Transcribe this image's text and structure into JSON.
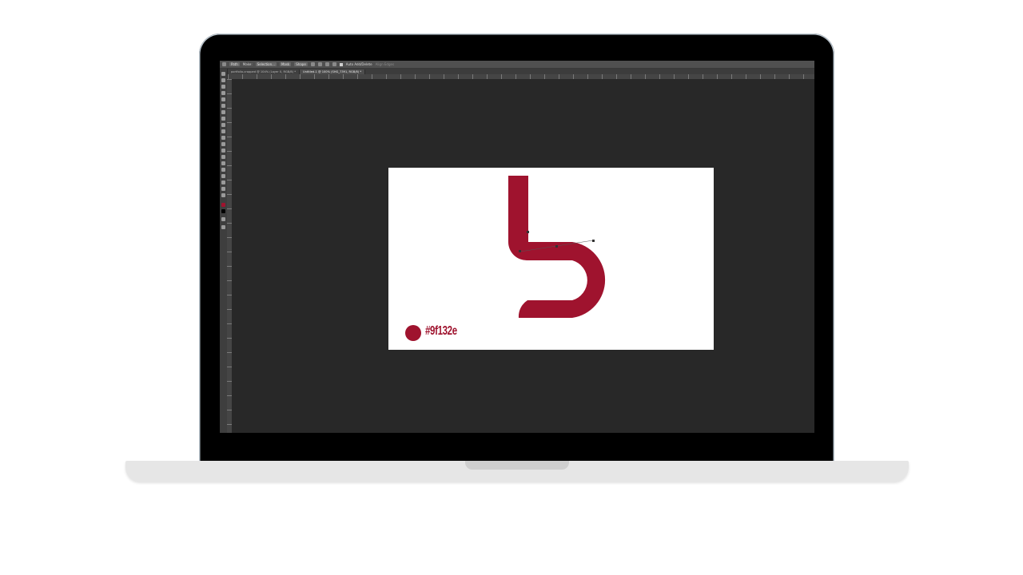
{
  "options_bar": {
    "tool_mode": "Path",
    "make_label": "Make:",
    "selection_button": "Selection...",
    "mask_button": "Mask",
    "shape_button": "Shape",
    "auto_add_delete": "Auto Add/Delete",
    "align_edges": "Align Edges"
  },
  "tabs": [
    {
      "label": "portfolio-cropped @ 104% (Layer 0, RGB/8) *"
    },
    {
      "label": "Untitled-1 @ 100% (SHG_7391, RGB/8) *"
    }
  ],
  "canvas": {
    "hex_label": "#9f132e",
    "accent_color": "#9f132e"
  }
}
